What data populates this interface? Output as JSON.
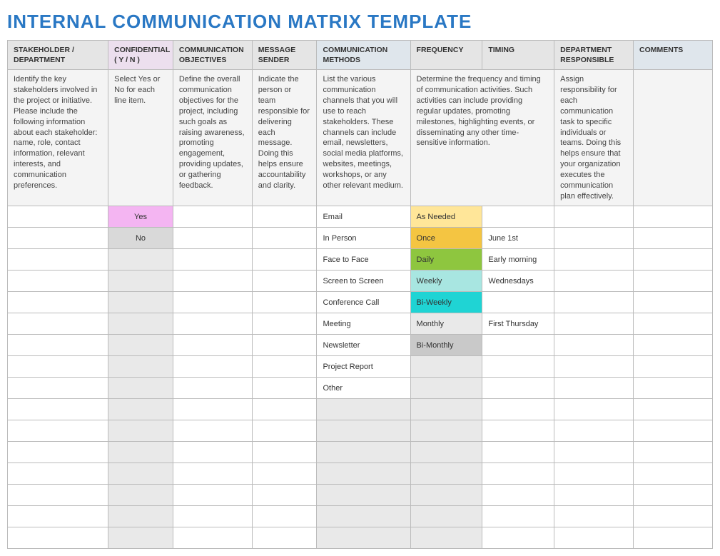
{
  "title": "INTERNAL COMMUNICATION MATRIX TEMPLATE",
  "headers": {
    "stakeholder": "STAKEHOLDER / DEPARTMENT",
    "confidential": "CONFIDENTIAL ( Y / N )",
    "objectives": "COMMUNICATION OBJECTIVES",
    "sender": "MESSAGE SENDER",
    "methods": "COMMUNICATION METHODS",
    "frequency": "FREQUENCY",
    "timing": "TIMING",
    "responsible": "DEPARTMENT RESPONSIBLE",
    "comments": "COMMENTS"
  },
  "descriptions": {
    "stakeholder": "Identify the key stakeholders involved in the project or initiative. Please include the following information about each stakeholder: name, role, contact information, relevant interests, and communication preferences.",
    "confidential": "Select Yes or No for each line item.",
    "objectives": "Define the overall communication objectives for the project, including such goals as raising awareness, promoting engagement, providing updates, or gathering feedback.",
    "sender": "Indicate the person or team responsible for delivering each message. Doing this helps ensure accountability and clarity.",
    "methods": "List the various communication channels that you will use to reach stakeholders. These channels can include email, newsletters, social media platforms, websites, meetings, workshops, or any other relevant medium.",
    "freq_timing": "Determine the frequency and timing of communication activities. Such activities can include providing regular updates, promoting milestones, highlighting events, or disseminating any other time-sensitive information.",
    "responsible": "Assign responsibility for each communication task to specific individuals or teams. Doing this helps ensure that your organization executes the communication plan effectively.",
    "comments": ""
  },
  "rows": [
    {
      "confidential": "Yes",
      "confClass": "c-yes",
      "method": "Email",
      "frequency": "As Needed",
      "freqClass": "c-asneeded",
      "timing": ""
    },
    {
      "confidential": "No",
      "confClass": "c-no",
      "method": "In Person",
      "frequency": "Once",
      "freqClass": "c-once",
      "timing": "June 1st"
    },
    {
      "confidential": "",
      "confClass": "",
      "method": "Face to Face",
      "frequency": "Daily",
      "freqClass": "c-daily",
      "timing": "Early morning"
    },
    {
      "confidential": "",
      "confClass": "",
      "method": "Screen to Screen",
      "frequency": "Weekly",
      "freqClass": "c-weekly",
      "timing": "Wednesdays"
    },
    {
      "confidential": "",
      "confClass": "",
      "method": "Conference Call",
      "frequency": "Bi-Weekly",
      "freqClass": "c-biweekly",
      "timing": ""
    },
    {
      "confidential": "",
      "confClass": "",
      "method": "Meeting",
      "frequency": "Monthly",
      "freqClass": "c-monthly",
      "timing": "First Thursday"
    },
    {
      "confidential": "",
      "confClass": "",
      "method": "Newsletter",
      "frequency": "Bi-Monthly",
      "freqClass": "c-bimonthly",
      "timing": ""
    },
    {
      "confidential": "",
      "confClass": "",
      "method": "Project Report",
      "frequency": "",
      "freqClass": "",
      "timing": ""
    },
    {
      "confidential": "",
      "confClass": "",
      "method": "Other",
      "frequency": "",
      "freqClass": "",
      "timing": ""
    }
  ],
  "emptyRowCount": 7
}
